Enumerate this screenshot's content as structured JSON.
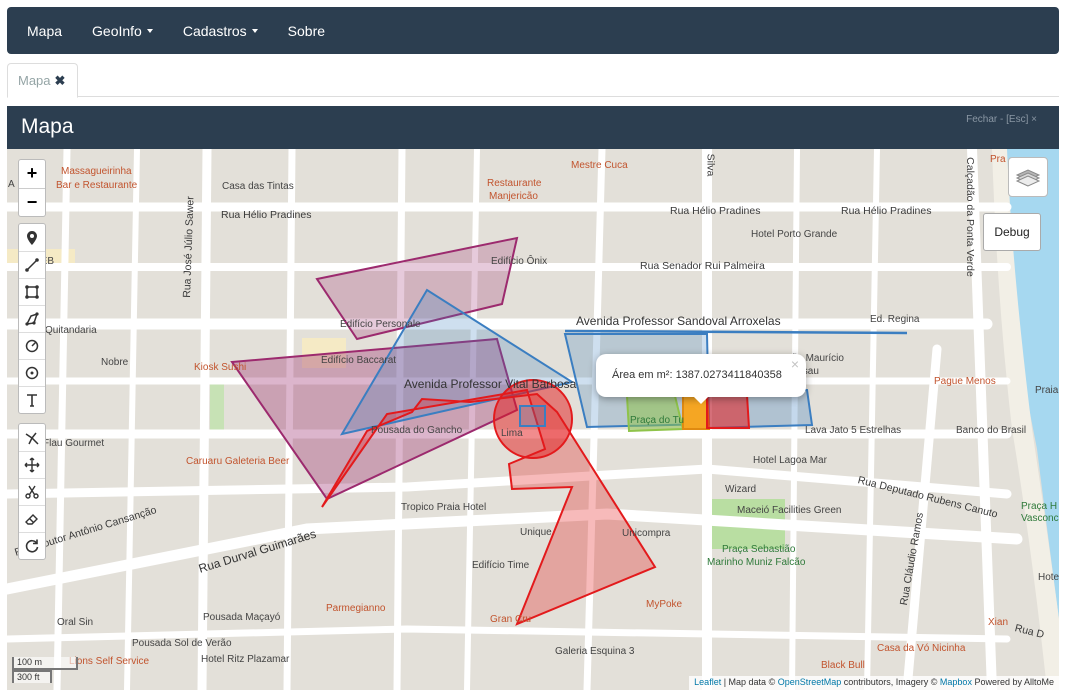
{
  "navbar": {
    "items": [
      {
        "label": "Mapa",
        "dropdown": false
      },
      {
        "label": "GeoInfo",
        "dropdown": true
      },
      {
        "label": "Cadastros",
        "dropdown": true
      },
      {
        "label": "Sobre",
        "dropdown": false
      }
    ]
  },
  "tabs": [
    {
      "label": "Mapa",
      "close_icon": "times-icon"
    }
  ],
  "panel": {
    "title": "Mapa",
    "close_label": "Fechar - [Esc] ×"
  },
  "map": {
    "zoom_in": "+",
    "zoom_out": "−",
    "debug_label": "Debug",
    "popup": {
      "text": "Área em m²: 1387.0273411840358",
      "close": "×"
    },
    "scale": {
      "metric": "100 m",
      "imperial": "300 ft"
    },
    "attribution": {
      "leaflet": "Leaflet",
      "sep1": " | Map data © ",
      "osm": "OpenStreetMap",
      "sep2": " contributors, Imagery © ",
      "mapbox": "Mapbox",
      "sep3": " Powered by AlltoMe"
    },
    "draw_tools": [
      "marker-icon",
      "polyline-icon",
      "rectangle-icon",
      "polygon-icon",
      "circle-icon",
      "circle-marker-icon",
      "text-icon"
    ],
    "edit_tools": [
      "cut-icon",
      "move-icon",
      "scissors-icon",
      "eraser-icon",
      "rotate-icon"
    ],
    "labels": {
      "massagueirinha": "Massagueirinha",
      "bar_restaurante": "Bar e Restaurante",
      "casa_tintas": "Casa das Tintas",
      "restaurante": "Restaurante",
      "manjericao": "Manjericão",
      "mestre_cuca": "Mestre Cuca",
      "rua_helio_1": "Rua Hélio Pradines",
      "rua_helio_2": "Rua Hélio Pradines",
      "rua_helio_3": "Rua Hélio Pradines",
      "hotel_porto": "Hotel Porto Grande",
      "rua_jose_julio": "Rua José Júlio Sawer",
      "edificio_onix": "Edifício Ônix",
      "rua_senador": "Rua Senador Rui Palmeira",
      "calcadao": "Calçadão da Ponta Verde",
      "silva": "Silva",
      "pra": "Pra",
      "seb": "SEB",
      "av_sandoval": "Avenida Professor Sandoval Arroxelas",
      "ed_regina": "Ed. Regina",
      "quitandaria": "Quitandaria",
      "edificio_personale": "Edifício Personale",
      "edificio_baccarat": "Edifício Baccarat",
      "nobre": "Nobre",
      "kiosk_sushi": "Kiosk Sushi",
      "sao_mauricio": "São Maurício",
      "nassau": "Nassau",
      "pague_menos": "Pague Menos",
      "praia": "Praia",
      "av_vital": "Avenida Professor Vital Barbosa",
      "pousada_gancho": "Pousada do Gancho",
      "lima": "Lima",
      "praca_tu": "Praça do Tu",
      "lava_jato": "Lava Jato 5 Estrelhas",
      "banco_brasil": "Banco do Brasil",
      "flau_gourmet": "Flau Gourmet",
      "caruaru": "Caruaru Galeteria Beer",
      "hotel_lagoa": "Hotel Lagoa Mar",
      "rua_deputado": "Rua Deputado Rubens Canuto",
      "wizard": "Wizard",
      "maceio_facilities": "Maceió Facilities Green",
      "praca_h": "Praça H",
      "vasconc": "Vasconc",
      "tropico": "Tropico Praia Hotel",
      "unique": "Unique",
      "unicompra": "Unicompra",
      "praca_sebastiao": "Praça Sebastião",
      "marinho": "Marinho Muniz Falcão",
      "rua_claudio": "Rua Cláudio Ramos",
      "rua_doutor": "Rua Doutor Antônio Cansanção",
      "rua_durval": "Rua Durval Guimarães",
      "edificio_time": "Edifício Time",
      "parmegianno": "Parmegianno",
      "mypoke": "MyPoke",
      "hote": "Hote",
      "pousada_macayo": "Pousada Maçayó",
      "oral_sin": "Oral Sin",
      "xian": "Xian",
      "rua_d": "Rua D",
      "gran_cru": "Gran Cru",
      "pousada_sol": "Pousada Sol de Verão",
      "hotel_ritz": "Hotel Ritz Plazamar",
      "lions": "Lions Self Service",
      "galeria": "Galeria Esquina 3",
      "black_bull": "Black Bull",
      "casa_vo": "Casa da Vó Nicinha",
      "abc_a": "A"
    }
  },
  "colors": {
    "navbar": "#2c3e50",
    "purple_polygon": "#9c2a6e",
    "blue_polygon": "#3b7ec1",
    "red_polygon": "#e31a1c",
    "green_polygon": "#8fc34a",
    "orange_polygon": "#f5a623",
    "water": "#a6d8f0"
  }
}
